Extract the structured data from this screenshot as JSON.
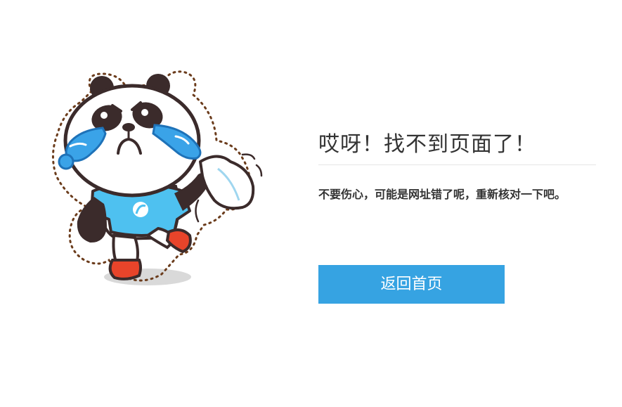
{
  "error": {
    "title": "哎呀！找不到页面了！",
    "message": "不要伤心，可能是网址错了呢，重新核对一下吧。",
    "home_button_label": "返回首页"
  },
  "illustration": {
    "icon": "crying-panda-illustration",
    "colors": {
      "shirt": "#4ec1f0",
      "tears": "#3aa3e8",
      "shoes": "#e8442a",
      "fur_dark": "#3b2b2b"
    }
  },
  "colors": {
    "accent": "#36a3e2",
    "text": "#333333",
    "divider": "#e6e6e6"
  }
}
